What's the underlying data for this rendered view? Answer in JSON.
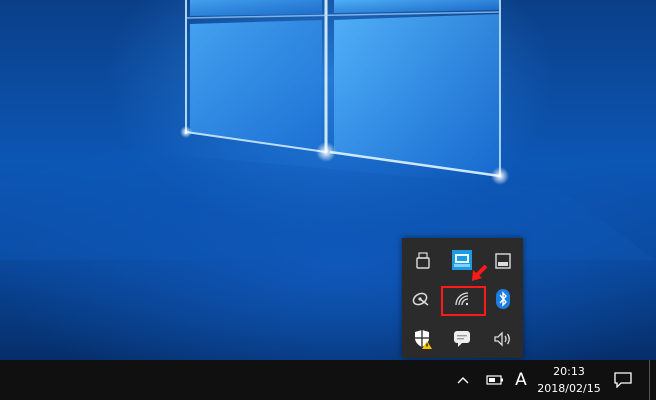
{
  "desktop": {
    "wallpaper": "windows-10-light-window",
    "colors": {
      "base": "#0a4aa0",
      "glow": "#3aa0ff",
      "taskbar": "#101010",
      "tray_popup": "#2b2b2b",
      "highlight": "#ff1a1a"
    }
  },
  "tray_popup": {
    "icons": [
      {
        "name": "usb-safely-remove-icon"
      },
      {
        "name": "network-manager-app-icon"
      },
      {
        "name": "display-icon"
      },
      {
        "name": "satellite-dish-icon"
      },
      {
        "name": "wifi-signal-icon",
        "highlighted": true
      },
      {
        "name": "bluetooth-icon"
      },
      {
        "name": "security-center-warning-icon"
      },
      {
        "name": "message-bubble-icon"
      },
      {
        "name": "speaker-volume-icon"
      }
    ]
  },
  "taskbar": {
    "show_hidden_icons": "chevron-up-icon",
    "battery": "battery-icon",
    "ime_label": "A",
    "clock": {
      "time": "20:13",
      "date": "2018/02/15"
    },
    "notifications": "action-center-icon"
  }
}
